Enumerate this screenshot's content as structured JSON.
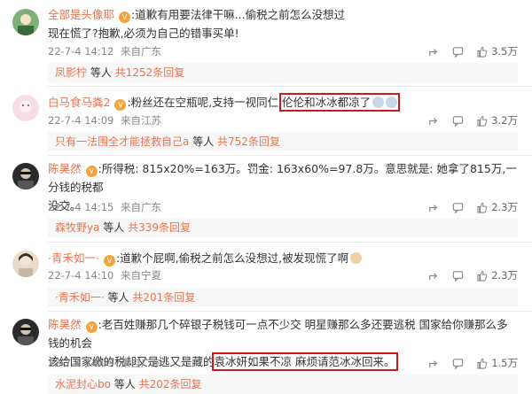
{
  "comments": [
    {
      "username": "全部是头像耶",
      "badge": "V",
      "before": ":道歉有用要法律干嘛...偷税之前怎么没想过",
      "highlight": "",
      "after": "?",
      "line2": "现在慌了?抱歉,必须为自己的错事买单!",
      "date": "22-7-4 14:12",
      "location": "来自广东",
      "shares": "",
      "likes": "3.5万",
      "reply_name": "凤影柠",
      "reply_mid": "等人",
      "reply_count": "共1252条回复"
    },
    {
      "username": "白马食马粪2",
      "badge": "V",
      "before": ":粉丝还在空瓶呢,支持一视同仁,",
      "highlight": "伦伦和冰冰都凉了",
      "after": "",
      "line2": "",
      "date": "22-7-4 14:09",
      "location": "来自江苏",
      "likes": "3.2万",
      "reply_name": "只有一法围全才能拯救自己a",
      "reply_mid": "等人",
      "reply_count": "共752条回复"
    },
    {
      "username": "陈昊然",
      "badge": "V",
      "before": ":所得税: 815x20%=163万。罚金: 163x60%=97.8万。意思就是: 她拿了815万,一分钱的税都",
      "highlight": "",
      "after": "",
      "line2": "没交。",
      "date": "22-7-4 14:15",
      "location": "来自广东",
      "likes": "2.3万",
      "reply_name": "森牧野ya",
      "reply_mid": "等人",
      "reply_count": "共339条回复"
    },
    {
      "username": "·青禾如一·",
      "badge": "V",
      "before": ":道歉个屁啊,偷税之前怎么没想过,被发现慌了啊",
      "highlight": "",
      "after": "",
      "line2": "",
      "date": "22-7-4 14:10",
      "location": "来自宁夏",
      "likes": "2.3万",
      "reply_name": "·青禾如一·",
      "reply_mid": "等人",
      "reply_count": "共201条回复"
    },
    {
      "username": "陈昊然",
      "badge": "V",
      "before": ":老百姓赚那几个碎银子税钱可一点不少交 明星赚那么多还要逃税 国家给你赚那么多钱的机会",
      "line2_before": "该给国家缴的税却又是逃又是藏的",
      "highlight": "袁冰妍如果不凉 麻烦请范冰冰回来。",
      "date": "22-7-4 14:09",
      "location": "来自广东",
      "likes": "1.5万",
      "reply_name": "水泥封心bo",
      "reply_mid": "等人",
      "reply_count": "共202条回复"
    }
  ],
  "icons": {
    "share": "share-icon",
    "comment": "comment-icon",
    "like": "thumbs-up-icon"
  }
}
